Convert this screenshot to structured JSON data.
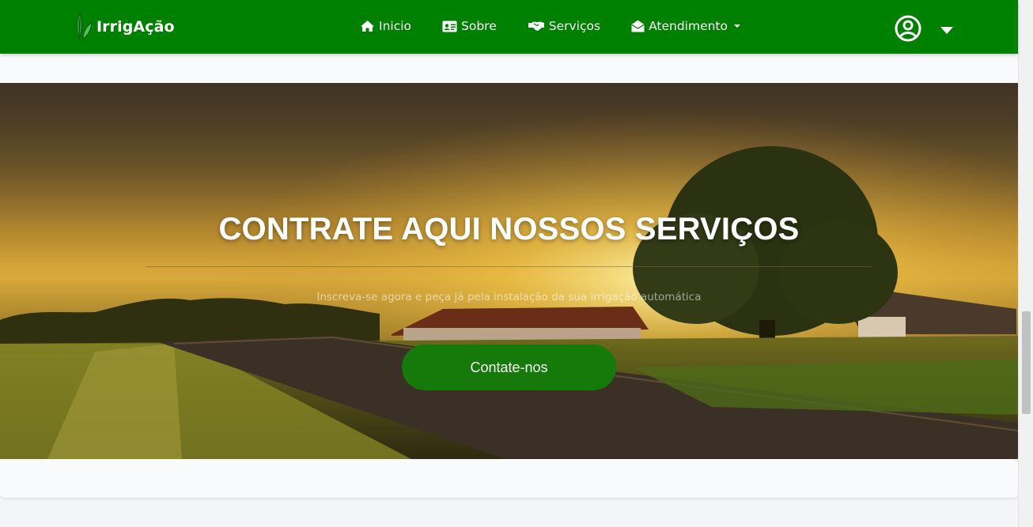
{
  "navbar": {
    "brand": "IrrigAção",
    "links": [
      {
        "label": "Inicio",
        "icon": "home-icon"
      },
      {
        "label": "Sobre",
        "icon": "id-card-icon"
      },
      {
        "label": "Serviços",
        "icon": "handshake-icon"
      },
      {
        "label": "Atendimento",
        "icon": "envelope-open-icon",
        "dropdown": true
      }
    ],
    "user_icon": "user-circle-icon",
    "color": "#008000"
  },
  "hero": {
    "title": "CONTRATE AQUI NOSSOS SERVIÇOS",
    "subtitle": "Inscreva-se agora e peça já pela instalação da sua irrigação automática",
    "cta_label": "Contate-nos",
    "cta_color": "#157a0a"
  }
}
